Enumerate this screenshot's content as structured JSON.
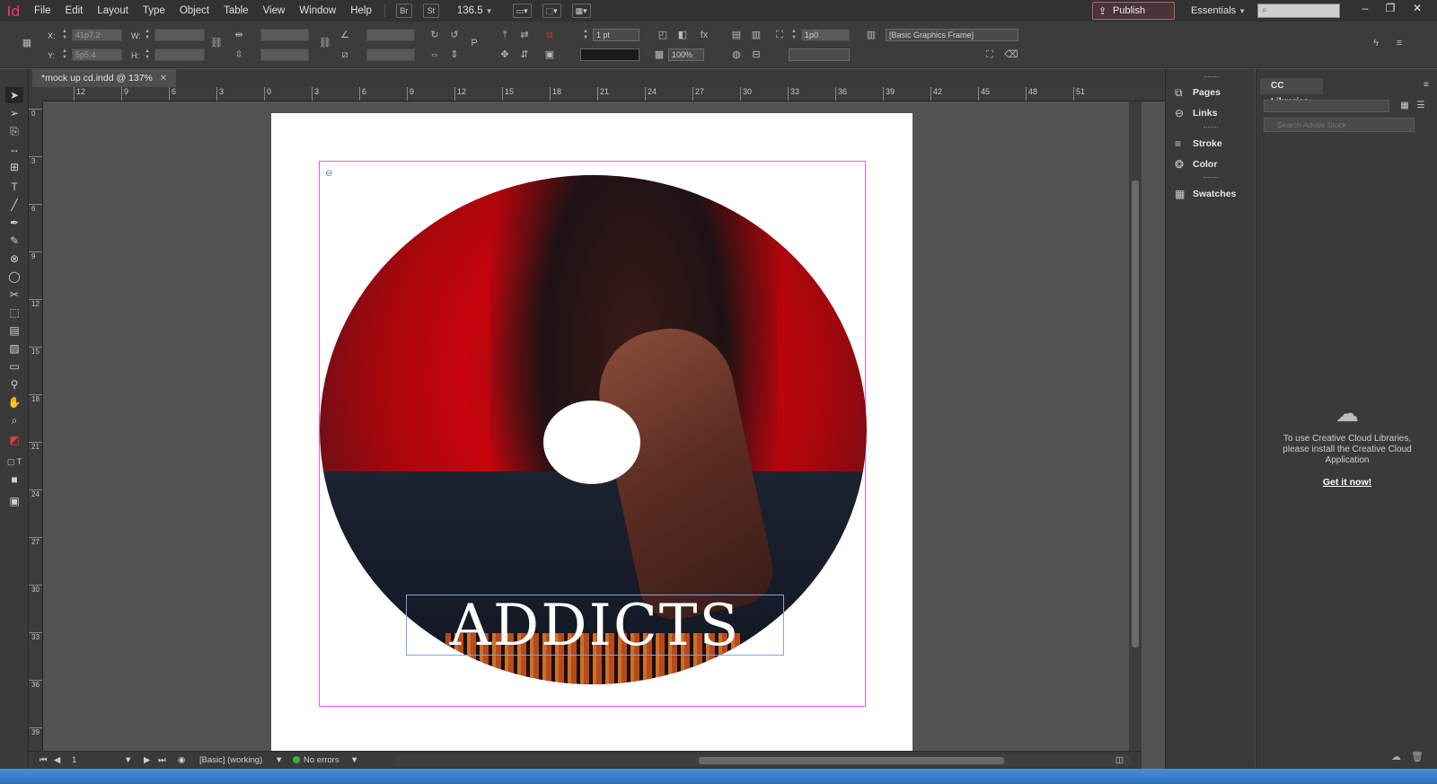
{
  "app": {
    "logo": "Id",
    "brand_color": "#ff3366"
  },
  "menu": [
    "File",
    "Edit",
    "Layout",
    "Type",
    "Object",
    "Table",
    "View",
    "Window",
    "Help"
  ],
  "menubar": {
    "bridge": "Br",
    "stock": "St",
    "zoom": "136.5",
    "publish_online": "Publish Online",
    "workspace": "Essentials"
  },
  "control_panel": {
    "x_label": "X:",
    "x_value": "41p7.2",
    "y_label": "Y:",
    "y_value": "5p5.4",
    "w_label": "W:",
    "h_label": "H:",
    "stroke_weight": "1 pt",
    "scale_percent": "100%",
    "offset_value": "1p0",
    "object_style": "[Basic Graphics Frame]"
  },
  "document": {
    "tab_title": "*mock up cd.indd @ 137%"
  },
  "ruler_h": [
    "12",
    "9",
    "6",
    "3",
    "0",
    "3",
    "6",
    "9",
    "12",
    "15",
    "18",
    "21",
    "24",
    "27",
    "30",
    "33",
    "36",
    "39",
    "42",
    "45",
    "48",
    "51"
  ],
  "ruler_v": [
    "0",
    "3",
    "6",
    "9",
    "12",
    "15",
    "18",
    "21",
    "24",
    "27",
    "30",
    "33",
    "36",
    "39"
  ],
  "artwork": {
    "title": "ADDICTS"
  },
  "status": {
    "page": "1",
    "profile": "[Basic] (working)",
    "preflight": "No errors",
    "preflight_color": "#38b538"
  },
  "panels": {
    "items": [
      "Pages",
      "Links",
      "Stroke",
      "Color",
      "Swatches"
    ]
  },
  "cc_libraries": {
    "tab": "CC Libraries",
    "search_placeholder": "Search Adobe Stock",
    "message": "To use Creative Cloud Libraries, please install the Creative Cloud Application",
    "cta": "Get it now!"
  }
}
